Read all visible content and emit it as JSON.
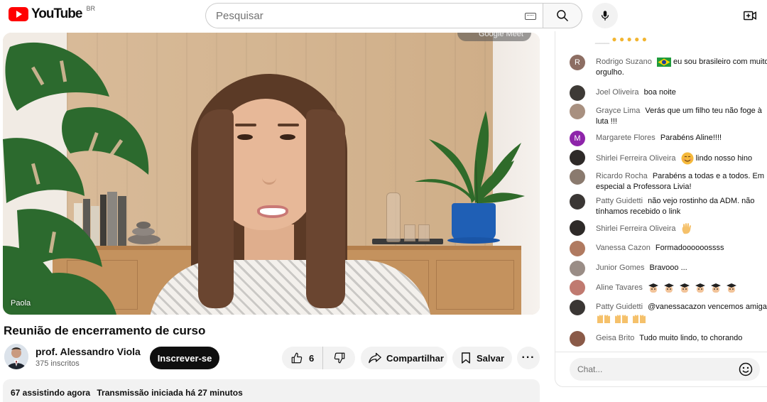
{
  "header": {
    "logo_text": "YouTube",
    "country_code": "BR",
    "search_placeholder": "Pesquisar"
  },
  "video": {
    "participant_label": "Paola",
    "meet_badge": "Google Meet",
    "title": "Reunião de encerramento de curso"
  },
  "channel": {
    "name": "prof. Alessandro Viola",
    "subscribers": "375 inscritos",
    "subscribe_label": "Inscrever-se"
  },
  "actions": {
    "like_count": "6",
    "share_label": "Compartilhar",
    "save_label": "Salvar"
  },
  "description": {
    "watching": "67 assistindo agora",
    "started": "Transmissão iniciada há 27 minutos"
  },
  "chat": {
    "input_placeholder": "Chat...",
    "messages": [
      {
        "author": "Rodrigo Suzano",
        "text": "eu sou brasileiro com muito orgulho.",
        "initial": "R",
        "avatar_color": "#8d6e63"
      },
      {
        "author": "Joel Oliveira",
        "text": "boa noite",
        "initial": "",
        "avatar_color": "#3e3a36"
      },
      {
        "author": "Grayce Lima",
        "text": "Verás que um filho teu não foge à luta !!!",
        "initial": "",
        "avatar_color": "#a89080"
      },
      {
        "author": "Margarete Flores",
        "text": "Parabéns Aline!!!!",
        "initial": "M",
        "avatar_color": "#8e24aa"
      },
      {
        "author": "Shirlei Ferreira Oliveira",
        "text": "lindo nosso hino",
        "initial": "",
        "avatar_color": "#2e2a28"
      },
      {
        "author": "Ricardo Rocha",
        "text": "Parabéns a todas e a todos. Em especial a Professora Livia!",
        "initial": "",
        "avatar_color": "#8a7a6e"
      },
      {
        "author": "Patty Guidetti",
        "text": "não vejo rostinho da ADM. não tínhamos recebido o link",
        "initial": "",
        "avatar_color": "#3a3634"
      },
      {
        "author": "Shirlei Ferreira Oliveira",
        "text": "",
        "initial": "",
        "avatar_color": "#2e2a28"
      },
      {
        "author": "Vanessa Cazon",
        "text": "Formadoooooossss",
        "initial": "",
        "avatar_color": "#b07a60"
      },
      {
        "author": "Junior Gomes",
        "text": "Bravooo ...",
        "initial": "",
        "avatar_color": "#9a8d86"
      },
      {
        "author": "Aline Tavares",
        "text": "",
        "initial": "",
        "avatar_color": "#c07a70"
      },
      {
        "author": "Patty Guidetti",
        "text": "@vanessacazon vencemos amiga",
        "initial": "",
        "avatar_color": "#3a3634"
      },
      {
        "author": "Geisa Brito",
        "text": "Tudo muito lindo, to chorando",
        "initial": "",
        "avatar_color": "#8a5a48"
      }
    ]
  },
  "colors": {
    "brand_red": "#ff0000",
    "subscribe_bg": "#0f0f0f",
    "pill_bg": "#f2f2f2"
  }
}
